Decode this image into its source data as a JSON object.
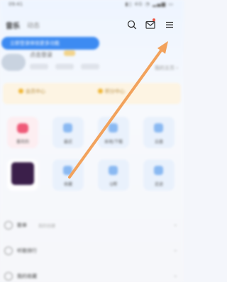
{
  "statusbar": {
    "time": "09:41",
    "icons": "▮▯ 4G ◔ ▂▄▆ ▭"
  },
  "tabs": {
    "active": "音乐",
    "inactive": "动态"
  },
  "header": {
    "icons": [
      "search-icon",
      "mail-icon",
      "menu-icon"
    ],
    "mail_badge_color": "#e54444"
  },
  "profile": {
    "banner_text": "立即登录体验更多功能",
    "subtitle": "点击登录",
    "homepage_link": "我的主页 ›"
  },
  "vip": {
    "item1": "会员中心",
    "item2": "积分中心"
  },
  "grid": {
    "tiles": [
      {
        "label": "喜欢的",
        "icon": "heart-icon"
      },
      {
        "label": "最近",
        "icon": "clock-icon"
      },
      {
        "label": "本地/下载",
        "icon": "download-icon"
      },
      {
        "label": "云盘",
        "icon": "cloud-icon"
      },
      {
        "label": "",
        "icon": "album-cover"
      },
      {
        "label": "收藏",
        "icon": "star-icon"
      },
      {
        "label": "Q帮",
        "icon": "search-icon"
      },
      {
        "label": "足迹",
        "icon": "music-note-icon"
      }
    ]
  },
  "list": {
    "rows": [
      {
        "label": "歌单",
        "sub": "我的创建"
      },
      {
        "label": "听歌排行",
        "sub": ""
      },
      {
        "label": "我的收藏",
        "sub": ""
      }
    ]
  },
  "annotation": {
    "arrow_color": "#f2a25c",
    "target": "menu-icon"
  }
}
